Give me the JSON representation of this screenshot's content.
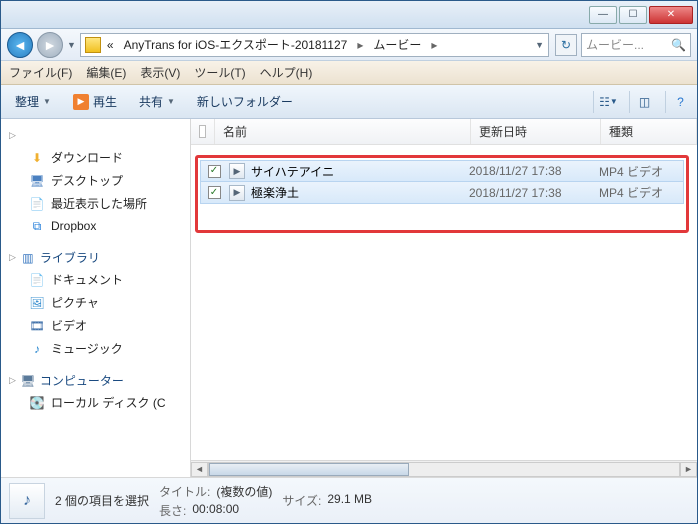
{
  "nav": {
    "back_enabled": true,
    "fwd_enabled": false,
    "crumbs_prefix": "«",
    "crumb1": "AnyTrans for iOS-エクスポート-20181127",
    "crumb2": "ムービー",
    "search_placeholder": "ムービー..."
  },
  "menu": {
    "file": "ファイル(F)",
    "edit": "編集(E)",
    "view": "表示(V)",
    "tools": "ツール(T)",
    "help": "ヘルプ(H)"
  },
  "toolbar": {
    "organize": "整理",
    "play": "再生",
    "share": "共有",
    "newfolder": "新しいフォルダー"
  },
  "sidebar": {
    "fav_items": [
      {
        "icon": "⬇",
        "color": "#f0b030",
        "label": "ダウンロード"
      },
      {
        "icon": "🖥",
        "color": "#4a80c0",
        "label": "デスクトップ"
      },
      {
        "icon": "📄",
        "color": "#c08850",
        "label": "最近表示した場所"
      },
      {
        "icon": "⧉",
        "color": "#1a78d8",
        "label": "Dropbox"
      }
    ],
    "lib_header": "ライブラリ",
    "lib_items": [
      {
        "icon": "📄",
        "color": "#c89860",
        "label": "ドキュメント"
      },
      {
        "icon": "🖼",
        "color": "#3a90d0",
        "label": "ピクチャ"
      },
      {
        "icon": "🎞",
        "color": "#2a60a0",
        "label": "ビデオ"
      },
      {
        "icon": "♪",
        "color": "#2a88d0",
        "label": "ミュージック"
      }
    ],
    "comp_header": "コンピューター",
    "comp_items": [
      {
        "icon": "💽",
        "color": "#6a6a6a",
        "label": "ローカル ディスク (C"
      }
    ]
  },
  "columns": {
    "name": "名前",
    "date": "更新日時",
    "type": "種類"
  },
  "files": [
    {
      "checked": true,
      "name": "サイハテアイニ",
      "date": "2018/11/27 17:38",
      "type": "MP4 ビデオ"
    },
    {
      "checked": true,
      "name": "極楽浄土",
      "date": "2018/11/27 17:38",
      "type": "MP4 ビデオ"
    }
  ],
  "status": {
    "selection": "2 個の項目を選択",
    "title_k": "タイトル:",
    "title_v": "(複数の値)",
    "length_k": "長さ:",
    "length_v": "00:08:00",
    "size_k": "サイズ:",
    "size_v": "29.1 MB"
  }
}
